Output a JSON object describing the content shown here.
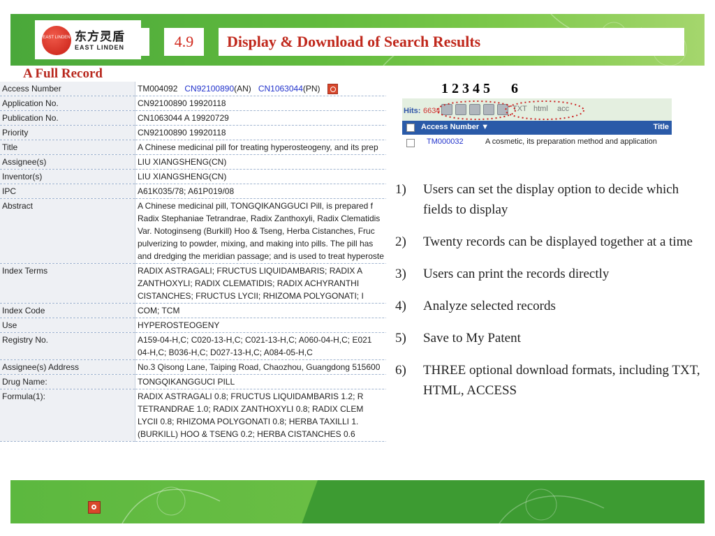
{
  "header": {
    "logo_cn": "东方灵盾",
    "logo_en": "EAST LINDEN",
    "logo_small": "EAST LINDEN",
    "section_number": "4.9",
    "title": "Display & Download of Search Results"
  },
  "record": {
    "heading": "A Full Record",
    "access": {
      "label": "Access Number",
      "id": "TM004092",
      "an_link": "CN92100890",
      "an_suffix": "(AN)",
      "pn_link": "CN1063044",
      "pn_suffix": "(PN)"
    },
    "rows": [
      {
        "label": "Application No.",
        "lines": [
          "CN92100890 19920118"
        ]
      },
      {
        "label": "Publication No.",
        "lines": [
          "CN1063044 A 19920729"
        ]
      },
      {
        "label": "Priority",
        "lines": [
          "CN92100890 19920118"
        ]
      },
      {
        "label": "Title",
        "lines": [
          "A Chinese medicinal pill for treating hyperosteogeny, and its prep"
        ]
      },
      {
        "label": "Assignee(s)",
        "lines": [
          "LIU XIANGSHENG(CN)"
        ]
      },
      {
        "label": "Inventor(s)",
        "lines": [
          "LIU XIANGSHENG(CN)"
        ]
      },
      {
        "label": "IPC",
        "lines": [
          "A61K035/78; A61P019/08"
        ]
      },
      {
        "label": "Abstract",
        "lines": [
          "A Chinese medicinal pill, TONGQIKANGGUCI Pill, is prepared f",
          "Radix Stephaniae Tetrandrae, Radix Zanthoxyli, Radix Clematidis",
          "Var. Notoginseng (Burkill) Hoo & Tseng, Herba Cistanches, Fruc",
          "pulverizing to powder, mixing, and making into pills. The pill has",
          "and dredging the meridian passage; and is used to treat hyperoste"
        ]
      },
      {
        "label": "Index Terms",
        "lines": [
          "RADIX ASTRAGALI; FRUCTUS LIQUIDAMBARIS; RADIX A",
          "ZANTHOXYLI; RADIX CLEMATIDIS; RADIX ACHYRANTHI",
          "CISTANCHES; FRUCTUS LYCII; RHIZOMA POLYGONATI; I"
        ]
      },
      {
        "label": "Index Code",
        "lines": [
          "COM; TCM"
        ]
      },
      {
        "label": "Use",
        "lines": [
          "HYPEROSTEOGENY"
        ]
      },
      {
        "label": "Registry No.",
        "lines": [
          "A159-04-H,C; C020-13-H,C; C021-13-H,C; A060-04-H,C; E021",
          "04-H,C; B036-H,C; D027-13-H,C; A084-05-H,C"
        ]
      },
      {
        "label": "Assignee(s) Address",
        "lines": [
          "No.3 Qisong Lane, Taiping Road, Chaozhou, Guangdong 515600"
        ]
      },
      {
        "label": "Drug Name:",
        "lines": [
          "TONGQIKANGGUCI PILL"
        ]
      },
      {
        "label": "Formula(1):",
        "lines": [
          "RADIX ASTRAGALI 0.8; FRUCTUS LIQUIDAMBARIS 1.2; R",
          "TETRANDRAE 1.0; RADIX ZANTHOXYLI 0.8; RADIX CLEM",
          "LYCII 0.8; RHIZOMA POLYGONATI 0.8; HERBA TAXILLI 1.",
          "(BURKILL) HOO & TSENG 0.2; HERBA CISTANCHES 0.6"
        ]
      }
    ]
  },
  "toolbar_detail": {
    "numbers": "1 2 3 4 5      6",
    "hits_label": "Hits:",
    "hits_count": "6634",
    "formats": [
      "TXT",
      "html",
      "acc"
    ],
    "col_access": "Access Number ▼",
    "col_title": "Title",
    "row_id": "TM000032",
    "row_title": "A cosmetic, its preparation method and application"
  },
  "notes": [
    {
      "num": "1)",
      "text": "Users can set the display option to decide which fields to display"
    },
    {
      "num": "2)",
      "text": "Twenty records can be displayed together at a time"
    },
    {
      "num": "3)",
      "text": "Users can print the records directly"
    },
    {
      "num": "4)",
      "text": "Analyze selected records"
    },
    {
      "num": "5)",
      "text": "Save to My Patent"
    },
    {
      "num": "6)",
      "text": "THREE optional download formats, including TXT, HTML, ACCESS"
    }
  ],
  "colors": {
    "title_red": "#c0281c",
    "banner_green": "#5cb83f",
    "link_blue": "#2233cc"
  }
}
